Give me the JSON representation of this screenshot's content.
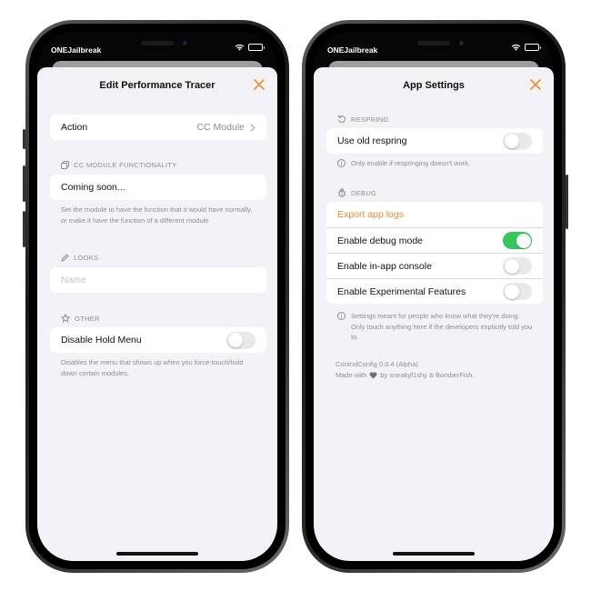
{
  "status_bar": {
    "carrier": "ONEJailbreak"
  },
  "left_screen": {
    "title": "Edit Performance Tracer",
    "action_row": {
      "label": "Action",
      "value": "CC Module"
    },
    "cc_section": {
      "header": "CC MODULE FUNCTIONALITY",
      "row_label": "Coming soon...",
      "footer": "Set the module to have the function that it would have normally, or make it have the function of a different module"
    },
    "looks_section": {
      "header": "LOOKS",
      "name_placeholder": "Name"
    },
    "other_section": {
      "header": "OTHER",
      "row_label": "Disable Hold Menu",
      "footer": "Disables the menu that shows up when you force-touch/hold down certain modules."
    }
  },
  "right_screen": {
    "title": "App Settings",
    "respring_section": {
      "header": "RESPRING",
      "row_label": "Use old respring",
      "footer": "Only enable if respringing doesn't work."
    },
    "debug_section": {
      "header": "DEBUG",
      "export_label": "Export app logs",
      "rows": [
        {
          "label": "Enable debug mode"
        },
        {
          "label": "Enable in-app console"
        },
        {
          "label": "Enable Experimental Features"
        }
      ],
      "footer": "Settings meant for people who know what they're doing. Only touch anything here if the developers explicitly told you to."
    },
    "version": "ControlConfig 0.0.4 (Alpha)",
    "credits": {
      "prefix": "Made with",
      "suffix": "by sneakyf1shy & BomberFish."
    }
  },
  "toggles": {
    "disable_hold_menu": false,
    "use_old_respring": false,
    "enable_debug_mode": true,
    "enable_in_app_console": false,
    "enable_experimental_features": false
  },
  "colors": {
    "accent": "#f08a2c",
    "toggle_on": "#34c759",
    "background": "#f2f2f7"
  },
  "icons": {
    "close": "x-mark-icon",
    "chevron": "chevron-right-icon",
    "copy": "copy-icon",
    "pen": "pen-icon",
    "star": "star-icon",
    "respring": "arrow-counterclockwise-icon",
    "debug": "ladybug-icon",
    "info": "info-circle-icon",
    "heart": "heart-icon",
    "wifi": "wifi-icon",
    "battery": "battery-icon"
  }
}
